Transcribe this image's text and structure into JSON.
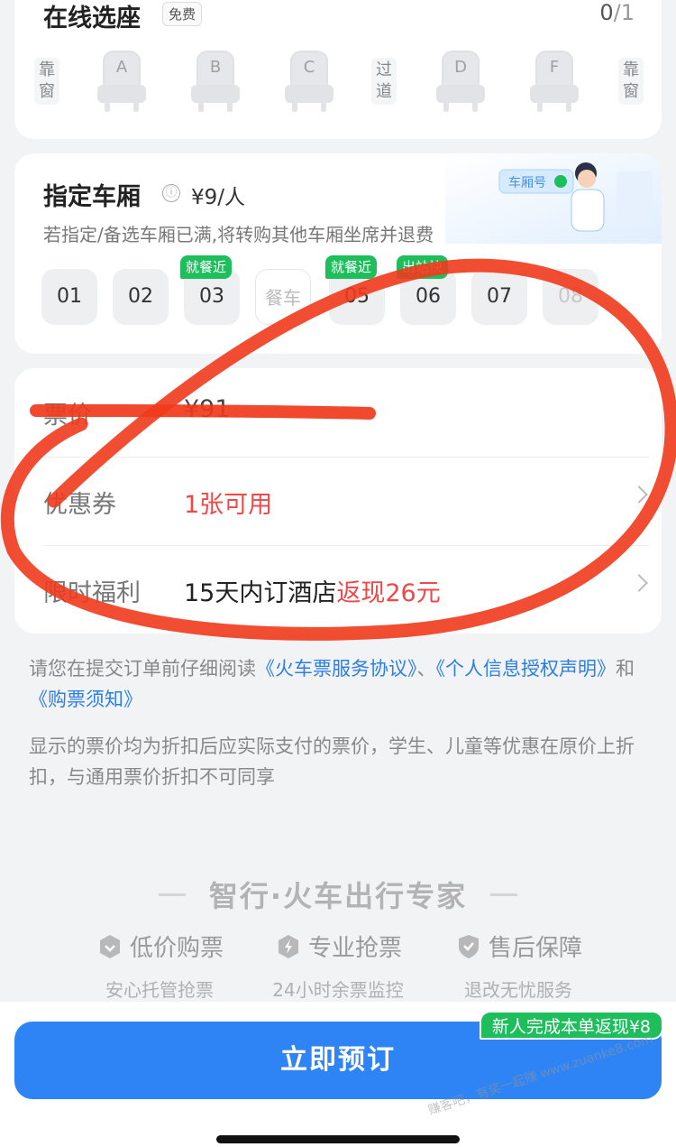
{
  "seat_section": {
    "title": "在线选座",
    "free_label": "免费",
    "count_selected": "0",
    "count_total": "/1",
    "left_window": "靠窗",
    "aisle": "过道",
    "right_window": "靠窗",
    "seats": [
      "A",
      "B",
      "C",
      "D",
      "F"
    ]
  },
  "carriage_section": {
    "title": "指定车厢",
    "info_icon": "ⓘ",
    "price": "¥9/人",
    "description": "若指定/备选车厢已满,将转购其他车厢坐席并退费",
    "deco_label": "车厢号",
    "carriages": [
      {
        "label": "01",
        "tag": ""
      },
      {
        "label": "02",
        "tag": ""
      },
      {
        "label": "03",
        "tag": "就餐近"
      },
      {
        "label": "餐车",
        "tag": ""
      },
      {
        "label": "05",
        "tag": "就餐近"
      },
      {
        "label": "06",
        "tag": "出站快"
      },
      {
        "label": "07",
        "tag": ""
      },
      {
        "label": "08",
        "tag": ""
      }
    ]
  },
  "price_section": {
    "ticket_label": "票价",
    "ticket_value": "¥91",
    "coupon_label": "优惠券",
    "coupon_value": "1张可用",
    "benefit_label": "限时福利",
    "benefit_text": "15天内订酒店",
    "benefit_highlight": "返现26元"
  },
  "notes": {
    "agreement_prefix": "请您在提交订单前仔细阅读",
    "link1": "《火车票服务协议》",
    "sep": "、",
    "link2": "《个人信息授权声明》",
    "and": "和",
    "link3": "《购票须知》",
    "disclaimer": "显示的票价均为折扣后应实际支付的票价，学生、儿童等优惠在原价上折扣，与通用票价折扣不可同享"
  },
  "brand": {
    "title": "智行·火车出行专家",
    "features": [
      {
        "icon": "discount-icon",
        "title": "低价购票",
        "sub": "安心托管抢票"
      },
      {
        "icon": "lightning-icon",
        "title": "专业抢票",
        "sub": "24小时余票监控"
      },
      {
        "icon": "shield-icon",
        "title": "售后保障",
        "sub": "退改无忧服务"
      }
    ]
  },
  "bottom": {
    "book_label": "立即预订",
    "promo": "新人完成本单返现¥8",
    "watermark": "赚客吧，有奖一起赚 www.zuanke8.com"
  },
  "colors": {
    "primary": "#2f84f5",
    "green_tag": "#1ebe5d",
    "red": "#f04848",
    "annotation": "#f03a1c"
  }
}
